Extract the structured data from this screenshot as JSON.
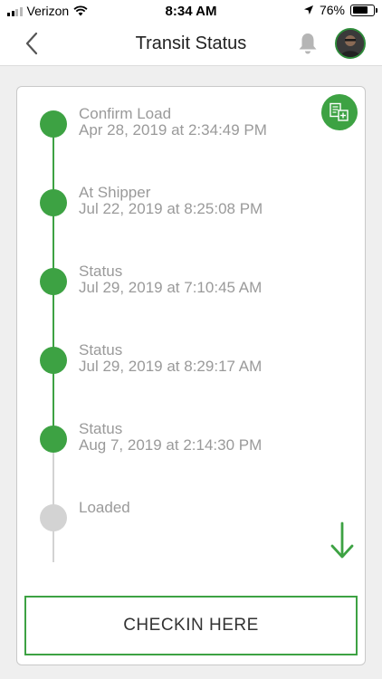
{
  "status_bar": {
    "carrier": "Verizon",
    "time": "8:34 AM",
    "battery": "76%",
    "battery_level": 0.76
  },
  "nav": {
    "title": "Transit Status"
  },
  "timeline": {
    "events": [
      {
        "title": "Confirm Load",
        "date": "Apr 28, 2019 at 2:34:49 PM",
        "completed": true
      },
      {
        "title": "At Shipper",
        "date": "Jul 22, 2019 at 8:25:08 PM",
        "completed": true
      },
      {
        "title": "Status",
        "date": "Jul 29, 2019 at 7:10:45 AM",
        "completed": true
      },
      {
        "title": "Status",
        "date": "Jul 29, 2019 at 8:29:17 AM",
        "completed": true
      },
      {
        "title": "Status",
        "date": "Aug 7, 2019 at 2:14:30 PM",
        "completed": true
      },
      {
        "title": "Loaded",
        "date": "",
        "completed": false
      }
    ]
  },
  "checkin_label": "CHECKIN HERE",
  "colors": {
    "accent": "#3da243",
    "pending": "#d3d3d3"
  }
}
